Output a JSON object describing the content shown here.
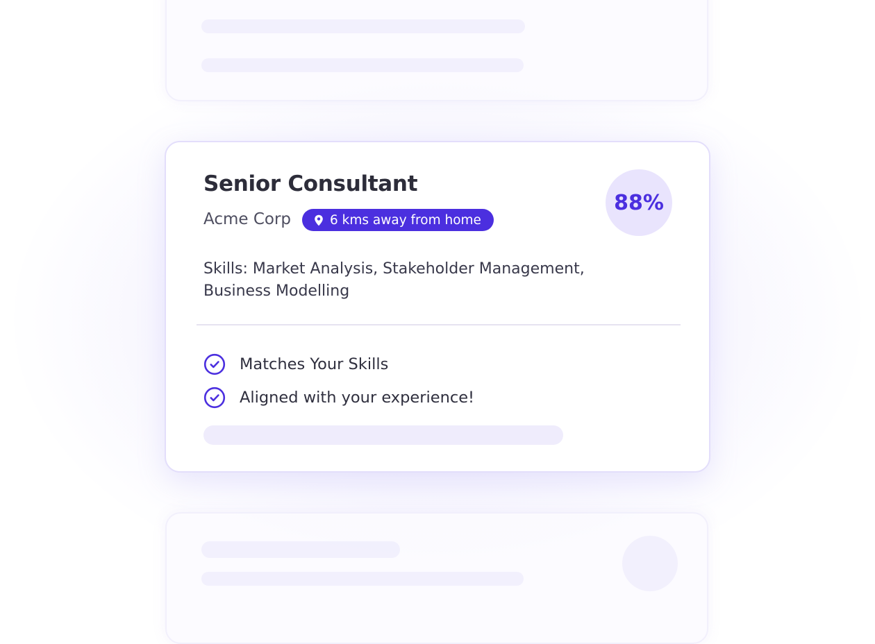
{
  "job_card": {
    "title": "Senior Consultant",
    "company": "Acme Corp",
    "distance": "6 kms away from home",
    "match_score": "88%",
    "skills": "Skills: Market Analysis, Stakeholder Management, Business Modelling",
    "highlights": [
      {
        "label": "Matches Your Skills",
        "icon": "check-circle-icon"
      },
      {
        "label": "Aligned with your experience!",
        "icon": "check-circle-icon"
      }
    ]
  },
  "colors": {
    "accent": "#4b2fdf",
    "accent_light": "#e9e4fd",
    "text_primary": "#2d2d3a",
    "skeleton": "#f1effd"
  },
  "icons": {
    "distance": "location-pin-icon",
    "highlight": "check-circle-icon"
  }
}
